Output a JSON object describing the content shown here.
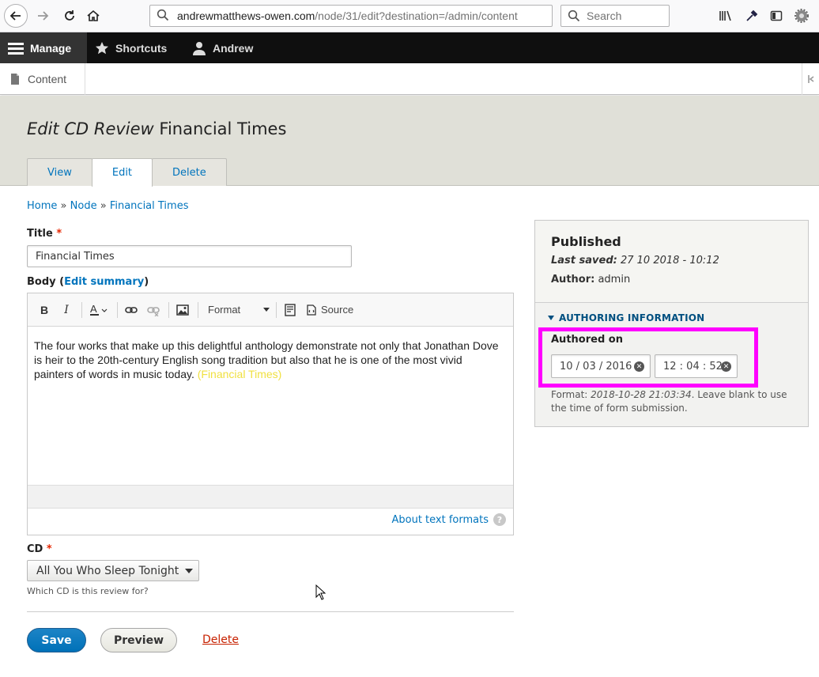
{
  "browser": {
    "url_domain": "andrewmatthews-owen.com",
    "url_path": "/node/31/edit?destination=/admin/content",
    "search_placeholder": "Search"
  },
  "toolbar": {
    "manage": "Manage",
    "shortcuts": "Shortcuts",
    "user": "Andrew",
    "tray_content": "Content"
  },
  "page": {
    "title_type": "Edit CD Review",
    "title_name": "Financial Times",
    "tabs": [
      "View",
      "Edit",
      "Delete"
    ]
  },
  "breadcrumb": {
    "items": [
      "Home",
      "Node",
      "Financial Times"
    ],
    "separator": "»"
  },
  "form": {
    "title_label": "Title",
    "title_value": "Financial Times",
    "body_label": "Body",
    "edit_summary": "Edit summary",
    "editor": {
      "format_label": "Format",
      "source_label": "Source",
      "body_text": "The four works that make up this delightful anthology demonstrate not only that Jonathan Dove is heir to the 20th-century English song tradition but also that he is one of the most vivid painters of words in music today.",
      "cite_text": "(Financial Times)"
    },
    "about_text_formats": "About text formats",
    "cd_label": "CD",
    "cd_value": "All You Who Sleep Tonight",
    "cd_description": "Which CD is this review for?",
    "save": "Save",
    "preview": "Preview",
    "delete": "Delete"
  },
  "sidebar": {
    "status": "Published",
    "last_saved_label": "Last saved:",
    "last_saved_value": "27 10 2018 - 10:12",
    "author_label": "Author:",
    "author_value": "admin",
    "section_title": "AUTHORING INFORMATION",
    "authored_on_label": "Authored on",
    "date_value": "10 / 03 / 2016",
    "time_value": "12 : 04 : 52",
    "format_prefix": "Format:",
    "format_example": "2018-10-28 21:03:34",
    "format_suffix": ". Leave blank to use the time of form submission."
  },
  "colors": {
    "link": "#0074bd",
    "highlight": "#ff00ff",
    "toolbar_bg": "#0f0f0f",
    "save_button": "#0071b8"
  }
}
